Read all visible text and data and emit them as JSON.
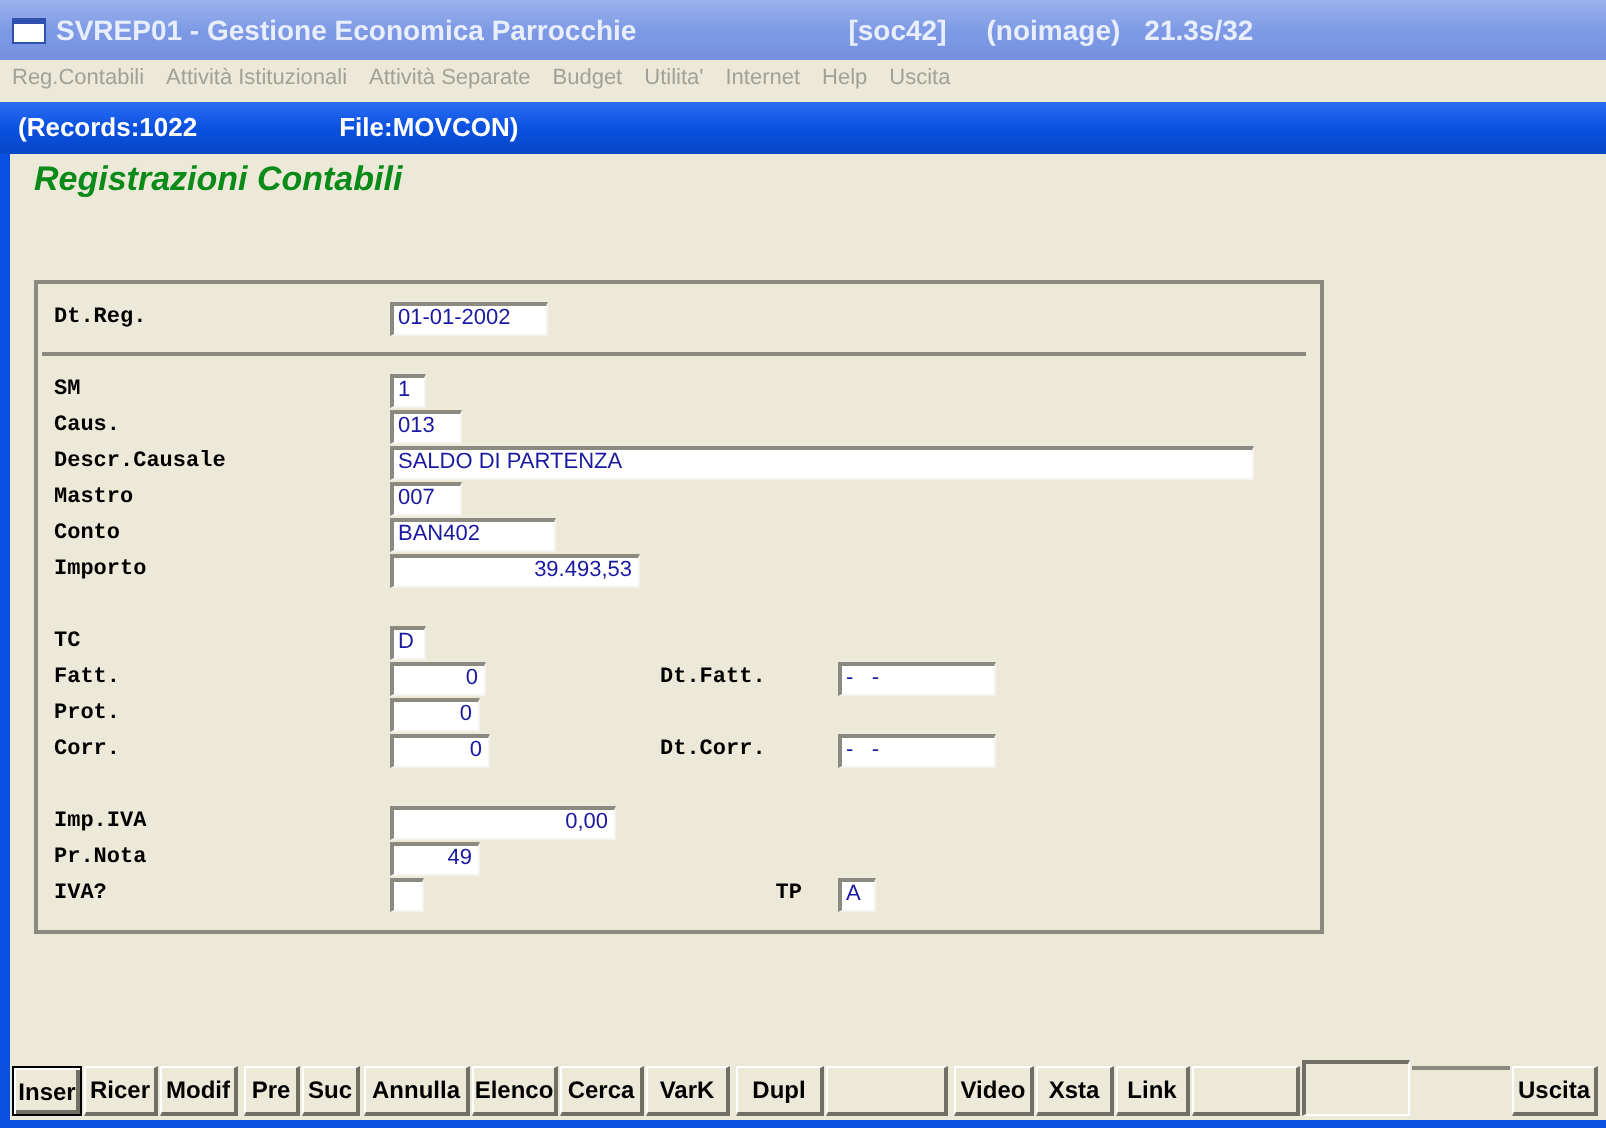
{
  "window": {
    "title": "SVREP01 - Gestione Economica Parrocchie",
    "company": "[soc42]",
    "image": "(noimage)",
    "version": "21.3s/32"
  },
  "menu": [
    {
      "label": "Reg.Contabili",
      "disabled": true
    },
    {
      "label": "Attività Istituzionali",
      "disabled": true
    },
    {
      "label": "Attività Separate",
      "disabled": true
    },
    {
      "label": "Budget",
      "disabled": true
    },
    {
      "label": "Utilita'",
      "disabled": true
    },
    {
      "label": "Internet",
      "disabled": true
    },
    {
      "label": "Help",
      "disabled": true
    },
    {
      "label": "Uscita",
      "disabled": true
    }
  ],
  "form_window": {
    "records": "(Records:1022",
    "file": "File:MOVCON)"
  },
  "heading": "Registrazioni Contabili",
  "header_fields": [
    {
      "label": "Dt.Reg.",
      "value": "01-01-2002"
    }
  ],
  "groups": [
    [
      {
        "label": "SM",
        "value": "1",
        "kind": "text"
      },
      {
        "label": "Caus.",
        "value": "013",
        "kind": "text"
      },
      {
        "label": "Descr.Causale",
        "value": "SALDO DI PARTENZA",
        "kind": "text"
      },
      {
        "label": "Mastro",
        "value": "007",
        "kind": "text"
      },
      {
        "label": "Conto",
        "value": "BAN402",
        "kind": "text"
      },
      {
        "label": "Importo",
        "value": "39.493,53",
        "kind": "number"
      }
    ],
    [
      {
        "label": "TC",
        "value": "D",
        "kind": "text"
      },
      {
        "label": "Fatt.",
        "value": "0",
        "kind": "number",
        "side": {
          "label": "Dt.Fatt.",
          "value": "-   -"
        }
      },
      {
        "label": "Prot.",
        "value": "0",
        "kind": "number"
      },
      {
        "label": "Corr.",
        "value": "0",
        "kind": "number",
        "side": {
          "label": "Dt.Corr.",
          "value": "-   -"
        }
      }
    ],
    [
      {
        "label": "Imp.IVA",
        "value": "0,00",
        "kind": "number"
      },
      {
        "label": "Pr.Nota",
        "value": "49",
        "kind": "number"
      },
      {
        "label": "IVA?",
        "side": {
          "label": "TP",
          "value": "A"
        }
      }
    ]
  ],
  "buttons": [
    {
      "kind": "button",
      "label": "Inser",
      "focused": true
    },
    {
      "kind": "button",
      "label": "Ricer",
      "focused": false
    },
    {
      "kind": "button",
      "label": "Modif",
      "focused": false
    },
    {
      "kind": "button",
      "label": "Pre",
      "focused": false
    },
    {
      "kind": "button",
      "label": "Suc",
      "focused": false
    },
    {
      "kind": "button",
      "label": "Annulla",
      "focused": false
    },
    {
      "kind": "button",
      "label": "Elenco",
      "focused": false
    },
    {
      "kind": "button",
      "label": "Cerca",
      "focused": false
    },
    {
      "kind": "button",
      "label": "VarK",
      "focused": false
    },
    {
      "kind": "button",
      "label": "Dupl",
      "focused": false
    },
    {
      "kind": "blank"
    },
    {
      "kind": "button",
      "label": "Video",
      "focused": false
    },
    {
      "kind": "button",
      "label": "Xsta",
      "focused": false
    },
    {
      "kind": "button",
      "label": "Link",
      "focused": false
    },
    {
      "kind": "blank"
    },
    {
      "kind": "sunken"
    },
    {
      "kind": "gap"
    },
    {
      "kind": "button",
      "label": "Uscita",
      "focused": false
    }
  ]
}
